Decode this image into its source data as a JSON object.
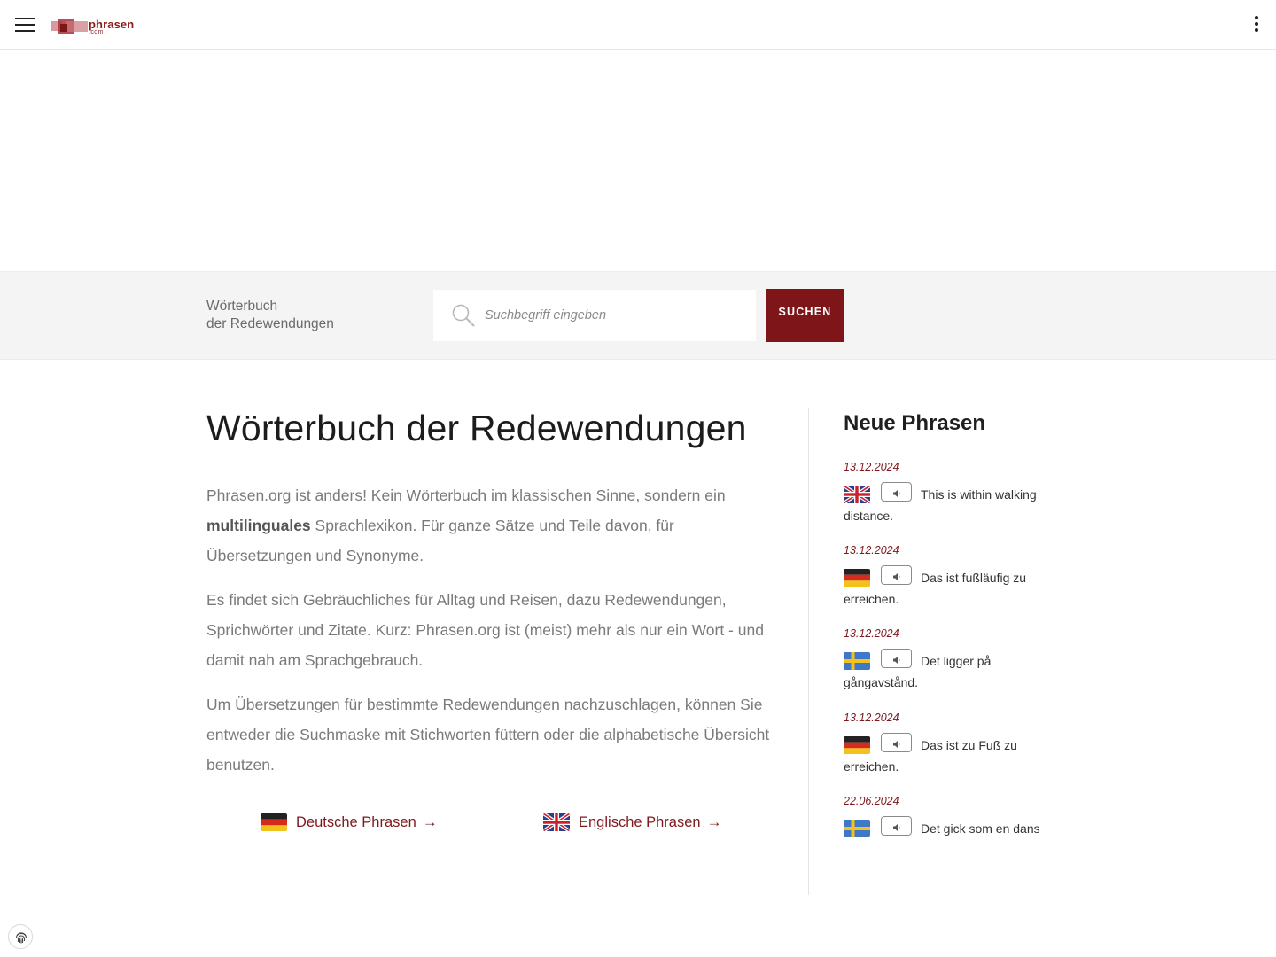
{
  "header": {
    "logo_text": "phrasen",
    "logo_sub": ".com",
    "menu_icon": "hamburger-icon",
    "more_icon": "kebab-menu-icon"
  },
  "search_band": {
    "label_line1": "Wörterbuch",
    "label_line2": "der Redewendungen",
    "placeholder": "Suchbegriff eingeben",
    "button_label": "SUCHEN",
    "search_icon": "search-icon"
  },
  "main": {
    "title": "Wörterbuch der Redewendungen",
    "p1_a": "Phrasen.org ist anders! Kein Wörterbuch im klassischen Sinne, sondern ein ",
    "p1_bold": "multilinguales",
    "p1_b": " Sprachlexikon. Für ganze Sätze und Teile davon, für Übersetzungen und Synonyme.",
    "p2": "Es findet sich Gebräuchliches für Alltag und Reisen, dazu Redewendungen, Sprichwörter und Zitate. Kurz: Phrasen.org ist (meist) mehr als nur ein Wort - und damit nah am Sprachgebrauch.",
    "p3": "Um Übersetzungen für bestimmte Redewendungen nachzuschlagen, können Sie entweder die Suchmaske mit Stichworten füttern oder die alphabetische Übersicht benutzen.",
    "links": [
      {
        "label": "Deutsche Phrasen",
        "flag": "de",
        "arrow": "→"
      },
      {
        "label": "Englische Phrasen",
        "flag": "gb",
        "arrow": "→"
      }
    ]
  },
  "sidebar": {
    "title": "Neue Phrasen",
    "entries": [
      {
        "date": "13.12.2024",
        "flag": "gb",
        "text": "This is within walking distance."
      },
      {
        "date": "13.12.2024",
        "flag": "de",
        "text": "Das ist fußläufig zu erreichen."
      },
      {
        "date": "13.12.2024",
        "flag": "se",
        "text": "Det ligger på gångavstånd."
      },
      {
        "date": "13.12.2024",
        "flag": "de",
        "text": "Das ist zu Fuß zu erreichen."
      },
      {
        "date": "22.06.2024",
        "flag": "se",
        "text": "Det gick som en dans"
      }
    ]
  },
  "colors": {
    "accent": "#7e1518",
    "link": "#7e1a1e",
    "band_bg": "#f4f4f4"
  }
}
